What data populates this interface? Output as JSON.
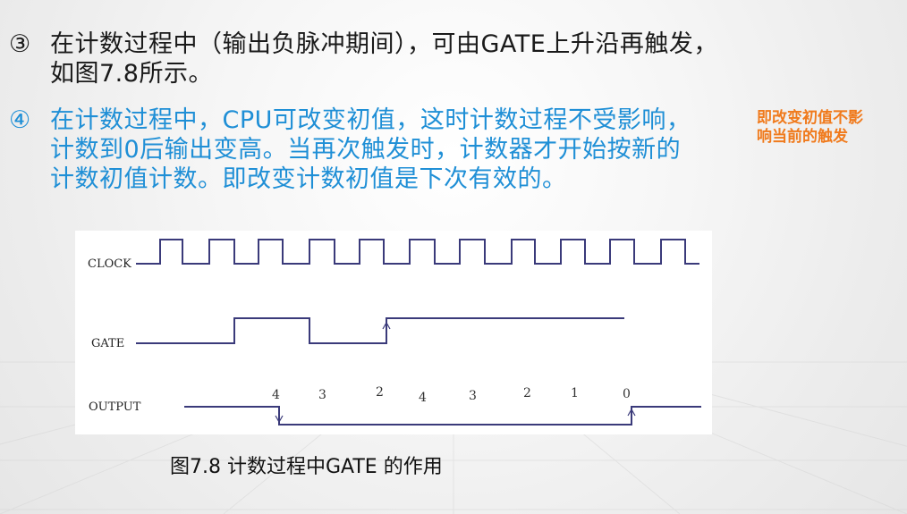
{
  "items": [
    {
      "marker": "③",
      "lines": [
        "在计数过程中（输出负脉冲期间），可由GATE上升沿再触发，",
        "如图7.8所示。"
      ]
    },
    {
      "marker": "④",
      "lines": [
        "在计数过程中，CPU可改变初值，这时计数过程不受影响，",
        "计数到0后输出变高。当再次触发时，计数器才开始按新的",
        "计数初值计数。即改变计数初值是下次有效的。"
      ]
    }
  ],
  "callout": {
    "lines": [
      "即改变初值不影",
      "响当前的触发"
    ]
  },
  "diagram": {
    "signals": {
      "clock": "CLOCK",
      "gate": "GATE",
      "output": "OUTPUT"
    },
    "count_labels": [
      "4",
      "3",
      "2",
      "4",
      "3",
      "2",
      "1",
      "0"
    ]
  },
  "caption": "图7.8 计数过程中GATE 的作用",
  "colors": {
    "body_text": "#1a1a1a",
    "item4_text": "#1f8fd6",
    "callout": "#f07a1c",
    "signal_line": "#3a3a7a"
  }
}
